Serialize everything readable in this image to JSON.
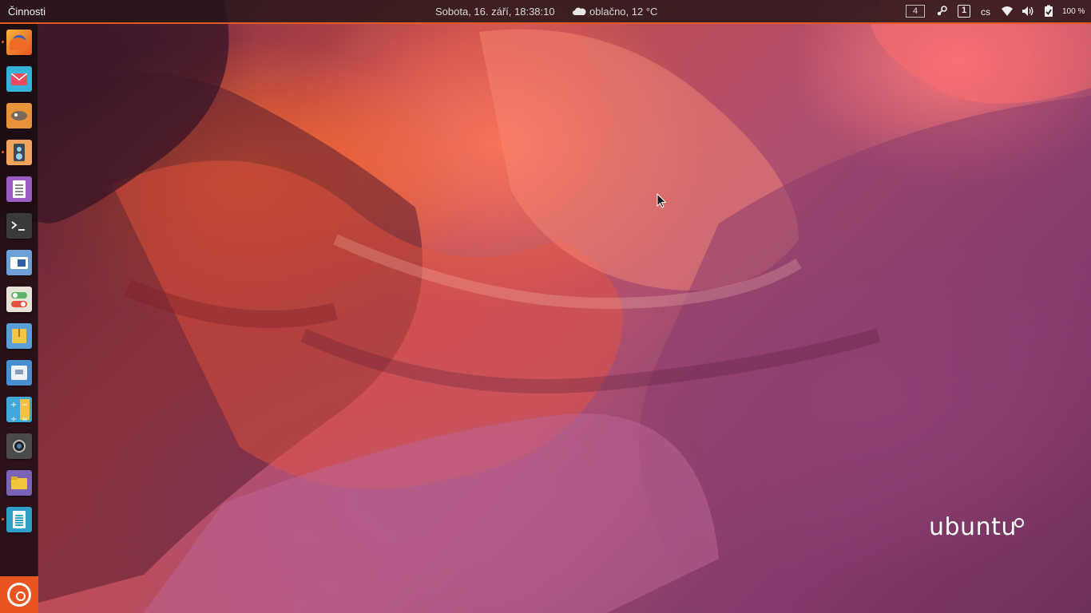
{
  "top_panel": {
    "activities_label": "Činnosti",
    "clock": "Sobota, 16. září, 18:38:10",
    "weather": "oblačno, 12 °C",
    "workspace_number": "4",
    "language": "cs",
    "battery_percent": "100 %",
    "accent_color": "#e05a2a"
  },
  "tray_icons": [
    "workspace-indicator",
    "steam-icon",
    "notification-count-icon",
    "keyboard-layout",
    "wifi-icon",
    "volume-icon",
    "battery-icon"
  ],
  "notification_count": "1",
  "launcher": {
    "items": [
      {
        "name": "firefox-icon",
        "running": true
      },
      {
        "name": "mail-icon",
        "running": false
      },
      {
        "name": "gimp-icon",
        "running": false
      },
      {
        "name": "speaker-app-icon",
        "running": true
      },
      {
        "name": "text-editor-icon",
        "running": false
      },
      {
        "name": "terminal-icon",
        "running": false
      },
      {
        "name": "remote-desktop-icon",
        "running": false
      },
      {
        "name": "settings-toggle-icon",
        "running": false
      },
      {
        "name": "archive-icon",
        "running": false
      },
      {
        "name": "disk-icon",
        "running": false
      },
      {
        "name": "calculator-icon",
        "running": false
      },
      {
        "name": "camera-icon",
        "running": false
      },
      {
        "name": "files-icon",
        "running": false
      },
      {
        "name": "document-icon",
        "running": true
      }
    ],
    "show_apps_icon": "ubuntu-logo-icon"
  },
  "desktop": {
    "brand_text": "ubuntu"
  }
}
